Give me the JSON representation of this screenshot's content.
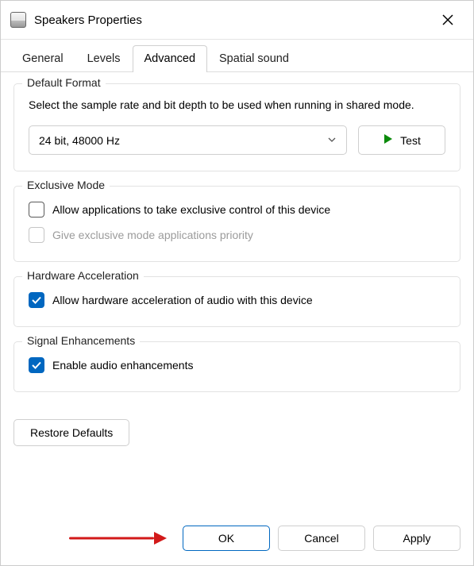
{
  "window": {
    "title": "Speakers Properties"
  },
  "tabs": {
    "general": "General",
    "levels": "Levels",
    "advanced": "Advanced",
    "spatial": "Spatial sound"
  },
  "default_format": {
    "title": "Default Format",
    "description": "Select the sample rate and bit depth to be used when running in shared mode.",
    "value": "24 bit, 48000 Hz",
    "test_label": "Test"
  },
  "exclusive_mode": {
    "title": "Exclusive Mode",
    "allow_exclusive": "Allow applications to take exclusive control of this device",
    "priority": "Give exclusive mode applications priority"
  },
  "hardware_accel": {
    "title": "Hardware Acceleration",
    "allow": "Allow hardware acceleration of audio with this device"
  },
  "signal_enh": {
    "title": "Signal Enhancements",
    "enable": "Enable audio enhancements"
  },
  "restore": "Restore Defaults",
  "footer": {
    "ok": "OK",
    "cancel": "Cancel",
    "apply": "Apply"
  }
}
